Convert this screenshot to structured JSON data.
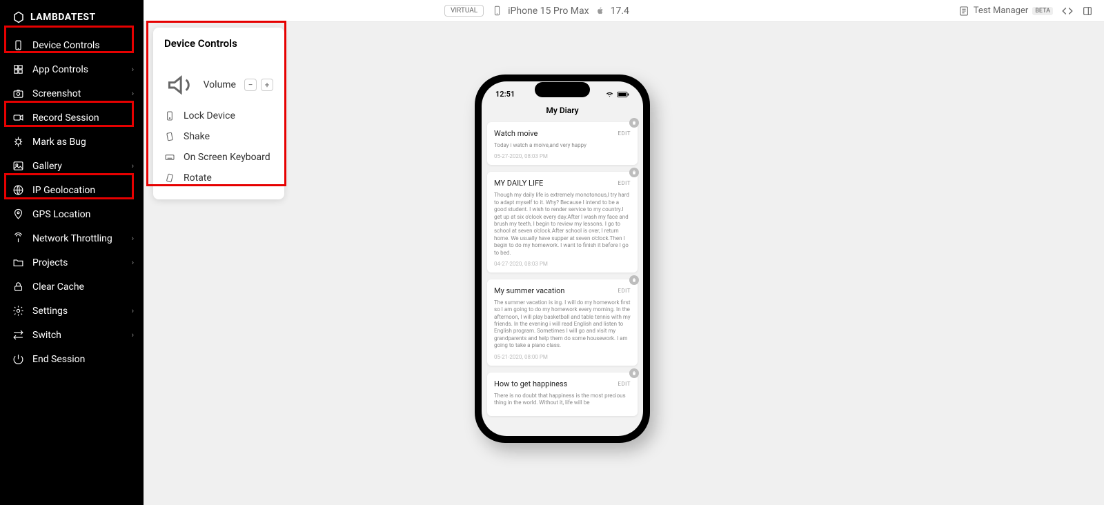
{
  "logo": "LAMBDATEST",
  "sidebar": [
    {
      "icon": "device",
      "label": "Device Controls",
      "chev": true
    },
    {
      "icon": "app",
      "label": "App Controls",
      "chev": true
    },
    {
      "icon": "screenshot",
      "label": "Screenshot",
      "chev": true
    },
    {
      "icon": "record",
      "label": "Record Session",
      "chev": false
    },
    {
      "icon": "bug",
      "label": "Mark as Bug",
      "chev": false
    },
    {
      "icon": "gallery",
      "label": "Gallery",
      "chev": true
    },
    {
      "icon": "geo",
      "label": "IP Geolocation",
      "chev": true
    },
    {
      "icon": "gps",
      "label": "GPS Location",
      "chev": false
    },
    {
      "icon": "network",
      "label": "Network Throttling",
      "chev": true
    },
    {
      "icon": "projects",
      "label": "Projects",
      "chev": true
    },
    {
      "icon": "cache",
      "label": "Clear Cache",
      "chev": false
    },
    {
      "icon": "settings",
      "label": "Settings",
      "chev": true
    },
    {
      "icon": "switch",
      "label": "Switch",
      "chev": true
    },
    {
      "icon": "end",
      "label": "End Session",
      "chev": false
    }
  ],
  "panel": {
    "title": "Device Controls",
    "volume_label": "Volume",
    "items": [
      "Lock Device",
      "Shake",
      "On Screen Keyboard",
      "Rotate"
    ]
  },
  "topbar": {
    "virtual": "VIRTUAL",
    "device": "iPhone 15 Pro Max",
    "os_version": "17.4",
    "test_manager": "Test Manager",
    "beta": "BETA"
  },
  "phone": {
    "time": "12:51",
    "diary_title": "My Diary",
    "edit_label": "EDIT",
    "entries": [
      {
        "title": "Watch moive",
        "body": "Today i watch a moive,and very happy",
        "date": "05-27-2020, 08:03 PM"
      },
      {
        "title": "MY DAILY LIFE",
        "body": "Though my daily life is extremely monotonous,I try hard to adapt myself to it. Why? Because I intend to be a good student. I wish to render service to my country.I get up at six o'clock every day.After I wash my face and brush my teeth, I begin to review my lessons. I go to school at seven o'clock.After school is over, I return home. We usually have supper at seven o'clock.Then I begin to do my homework. I want to finish it before I go to bed.",
        "date": "04-27-2020, 08:03 PM"
      },
      {
        "title": "My summer vacation",
        "body": "The summer vacation is ing. I will do my homework first so I am going to do my homework every morning. In the afternoon, I will play basketball and table tennis with my friends. In the evening i will read English and listen to English program. Sometimes I will go and visit my grandparents and help them do some housework. I am going to take a piano class.",
        "date": "05-21-2020, 08:00 PM"
      },
      {
        "title": "How to get happiness",
        "body": "There is no doubt that happiness is the most precious thing in the world. Without it, life will be",
        "date": ""
      }
    ]
  }
}
